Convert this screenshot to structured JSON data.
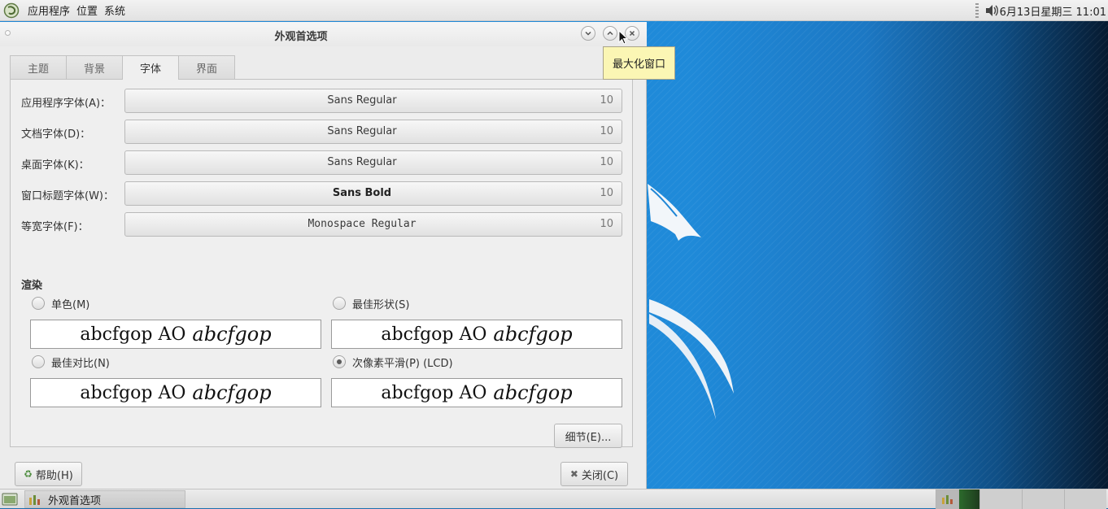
{
  "top_panel": {
    "menus": [
      "应用程序",
      "位置",
      "系统"
    ],
    "clock": "6月13日星期三 11:01"
  },
  "dialog": {
    "title": "外观首选项",
    "tooltip": "最大化窗口",
    "tabs": [
      {
        "label": "主题"
      },
      {
        "label": "背景"
      },
      {
        "label": "字体"
      },
      {
        "label": "界面"
      }
    ],
    "fonts": [
      {
        "label": "应用程序字体(A)：",
        "font": "Sans Regular",
        "size": "10"
      },
      {
        "label": "文档字体(D)：",
        "font": "Sans Regular",
        "size": "10"
      },
      {
        "label": "桌面字体(K)：",
        "font": "Sans Regular",
        "size": "10"
      },
      {
        "label": "窗口标题字体(W)：",
        "font": "Sans Bold",
        "size": "10"
      },
      {
        "label": "等宽字体(F)：",
        "font": "Monospace Regular",
        "size": "10"
      }
    ],
    "rendering": {
      "title": "渲染",
      "options": [
        {
          "label": "单色(M)",
          "checked": false,
          "sample_regular": "abcfgop AO",
          "sample_italic": "abcfgop"
        },
        {
          "label": "最佳形状(S)",
          "checked": false,
          "sample_regular": "abcfgop AO",
          "sample_italic": "abcfgop"
        },
        {
          "label": "最佳对比(N)",
          "checked": false,
          "sample_regular": "abcfgop AO",
          "sample_italic": "abcfgop"
        },
        {
          "label": "次像素平滑(P) (LCD)",
          "checked": true,
          "sample_regular": "abcfgop AO",
          "sample_italic": "abcfgop"
        }
      ]
    },
    "details_button": "细节(E)...",
    "help_button": "帮助(H)",
    "close_button": "关闭(C)"
  },
  "bottom_panel": {
    "task_label": "外观首选项"
  }
}
